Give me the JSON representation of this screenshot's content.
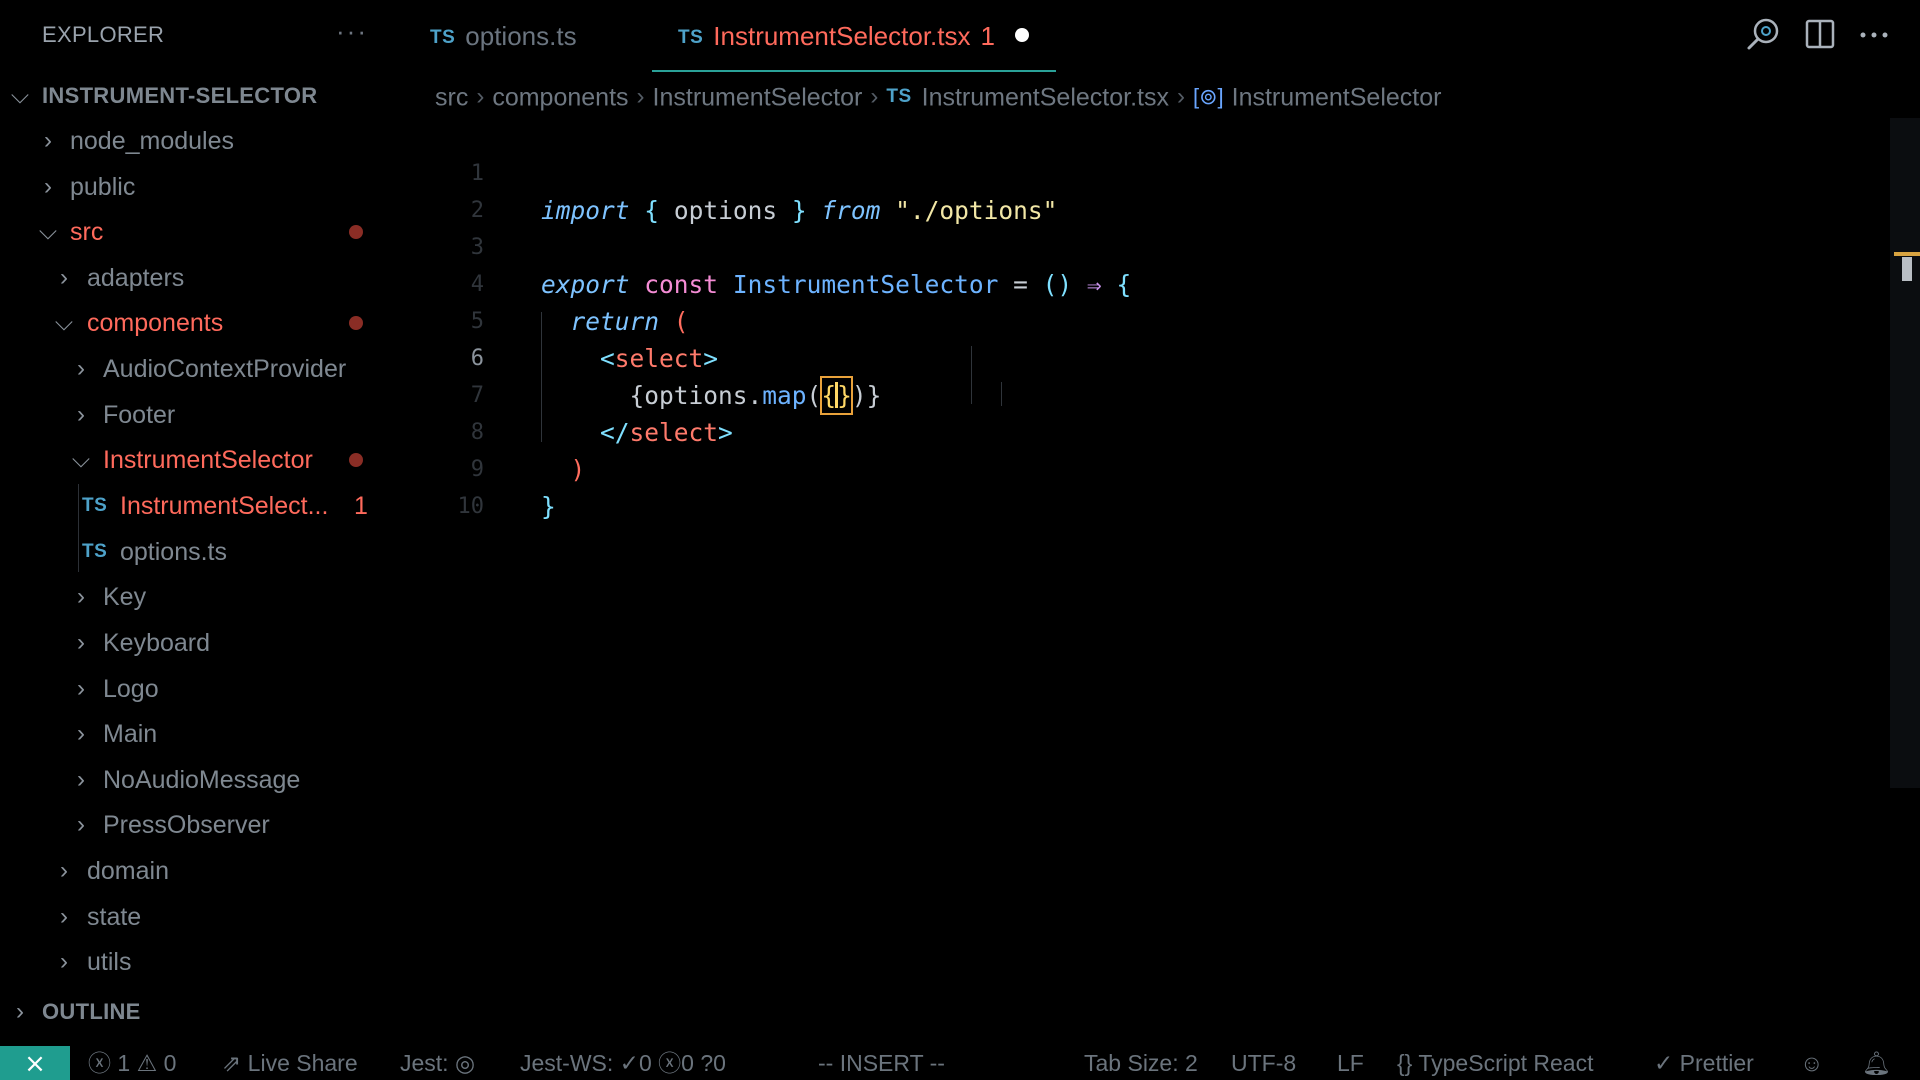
{
  "sidebar": {
    "title": "EXPLORER",
    "more": "···",
    "root": "INSTRUMENT-SELECTOR",
    "items": [
      {
        "label": "node_modules"
      },
      {
        "label": "public"
      },
      {
        "label": "src"
      },
      {
        "label": "adapters"
      },
      {
        "label": "components"
      },
      {
        "label": "AudioContextProvider"
      },
      {
        "label": "Footer"
      },
      {
        "label": "InstrumentSelector"
      },
      {
        "label": "InstrumentSelect...",
        "badge": "TS",
        "errors": "1"
      },
      {
        "label": "options.ts",
        "badge": "TS"
      },
      {
        "label": "Key"
      },
      {
        "label": "Keyboard"
      },
      {
        "label": "Logo"
      },
      {
        "label": "Main"
      },
      {
        "label": "NoAudioMessage"
      },
      {
        "label": "PressObserver"
      },
      {
        "label": "domain"
      },
      {
        "label": "state"
      },
      {
        "label": "utils"
      }
    ],
    "outline": "OUTLINE"
  },
  "tabs": [
    {
      "badge": "TS",
      "label": "options.ts"
    },
    {
      "badge": "TS",
      "label": "InstrumentSelector.tsx",
      "problems": "1"
    }
  ],
  "breadcrumb": {
    "parts": [
      "src",
      "components",
      "InstrumentSelector"
    ],
    "file_badge": "TS",
    "file": "InstrumentSelector.tsx",
    "symbol": "InstrumentSelector"
  },
  "editor": {
    "line_numbers": [
      "1",
      "2",
      "3",
      "4",
      "5",
      "6",
      "7",
      "8",
      "9",
      "10"
    ],
    "current_line": "6"
  },
  "status": {
    "errors": "1",
    "warnings": "0",
    "live_share": "Live Share",
    "jest": "Jest:",
    "jest_ws": "Jest-WS:",
    "ws_pass": "0",
    "ws_fail": "0",
    "ws_unknown": "0",
    "mode": "-- INSERT --",
    "tab_size": "Tab Size: 2",
    "encoding": "UTF-8",
    "eol": "LF",
    "language": "TypeScript React",
    "formatter": "Prettier"
  },
  "colors": {
    "background": "#000000",
    "modified": "#ff6a5c",
    "accent": "#1f9d8f",
    "ts_badge": "#4ea2c9"
  }
}
